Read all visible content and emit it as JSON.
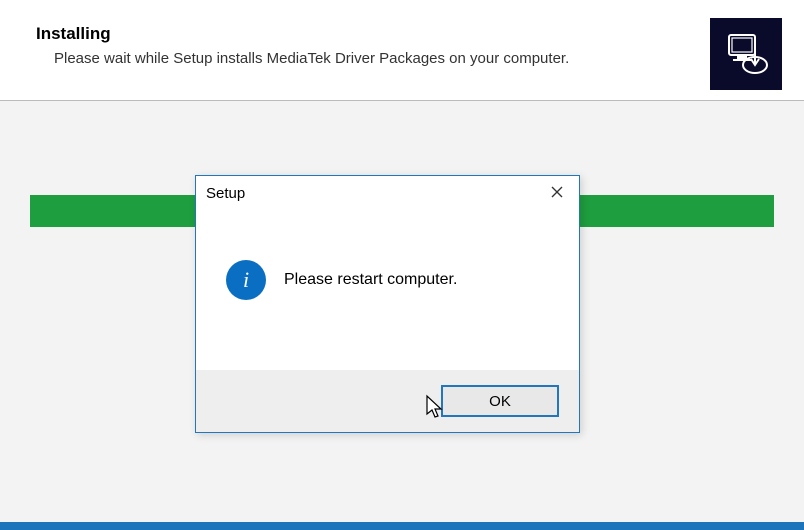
{
  "header": {
    "title": "Installing",
    "subtitle": "Please wait while Setup installs MediaTek Driver Packages on your computer."
  },
  "dialog": {
    "title": "Setup",
    "message": "Please restart computer.",
    "ok_label": "OK"
  },
  "colors": {
    "progress": "#1e9e3e",
    "accent": "#2176bd",
    "info": "#0a6fc2"
  }
}
